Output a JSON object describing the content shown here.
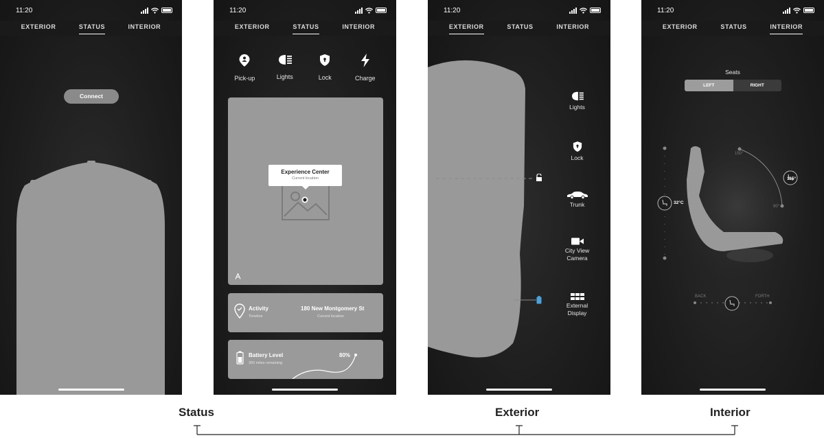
{
  "status_bar": {
    "time": "11:20"
  },
  "tabs": [
    "EXTERIOR",
    "STATUS",
    "INTERIOR"
  ],
  "screen1": {
    "connect_label": "Connect"
  },
  "screen2": {
    "actions": [
      "Pick-up",
      "Lights",
      "Lock",
      "Charge"
    ],
    "map": {
      "place": "Experience Center",
      "place_sub": "Current location"
    },
    "activity": {
      "title": "Activity",
      "sub": "Timeline",
      "address": "180 New Montgomery St",
      "address_sub": "Current location"
    },
    "battery": {
      "title": "Battery Level",
      "sub": "350 miles remaining",
      "percent": "80%"
    }
  },
  "screen3": {
    "controls": [
      {
        "label": "Lights",
        "icon": "headlight-icon"
      },
      {
        "label": "Lock",
        "icon": "shield-lock-icon"
      },
      {
        "label": "Trunk",
        "icon": "car-icon"
      },
      {
        "label_line1": "City View",
        "label_line2": "Camera",
        "icon": "camera-icon"
      },
      {
        "label_line1": "External",
        "label_line2": "Display",
        "icon": "grid-icon"
      }
    ]
  },
  "screen4": {
    "seats_title": "Seats",
    "seg_left": "LEFT",
    "seg_right": "RIGHT",
    "temperature": "32°C",
    "angle": "115°",
    "angle_max": "150°",
    "angle_min": "90°",
    "back_label": "BACK",
    "forth_label": "FORTH"
  },
  "captions": {
    "status": "Status",
    "exterior": "Exterior",
    "interior": "Interior"
  }
}
